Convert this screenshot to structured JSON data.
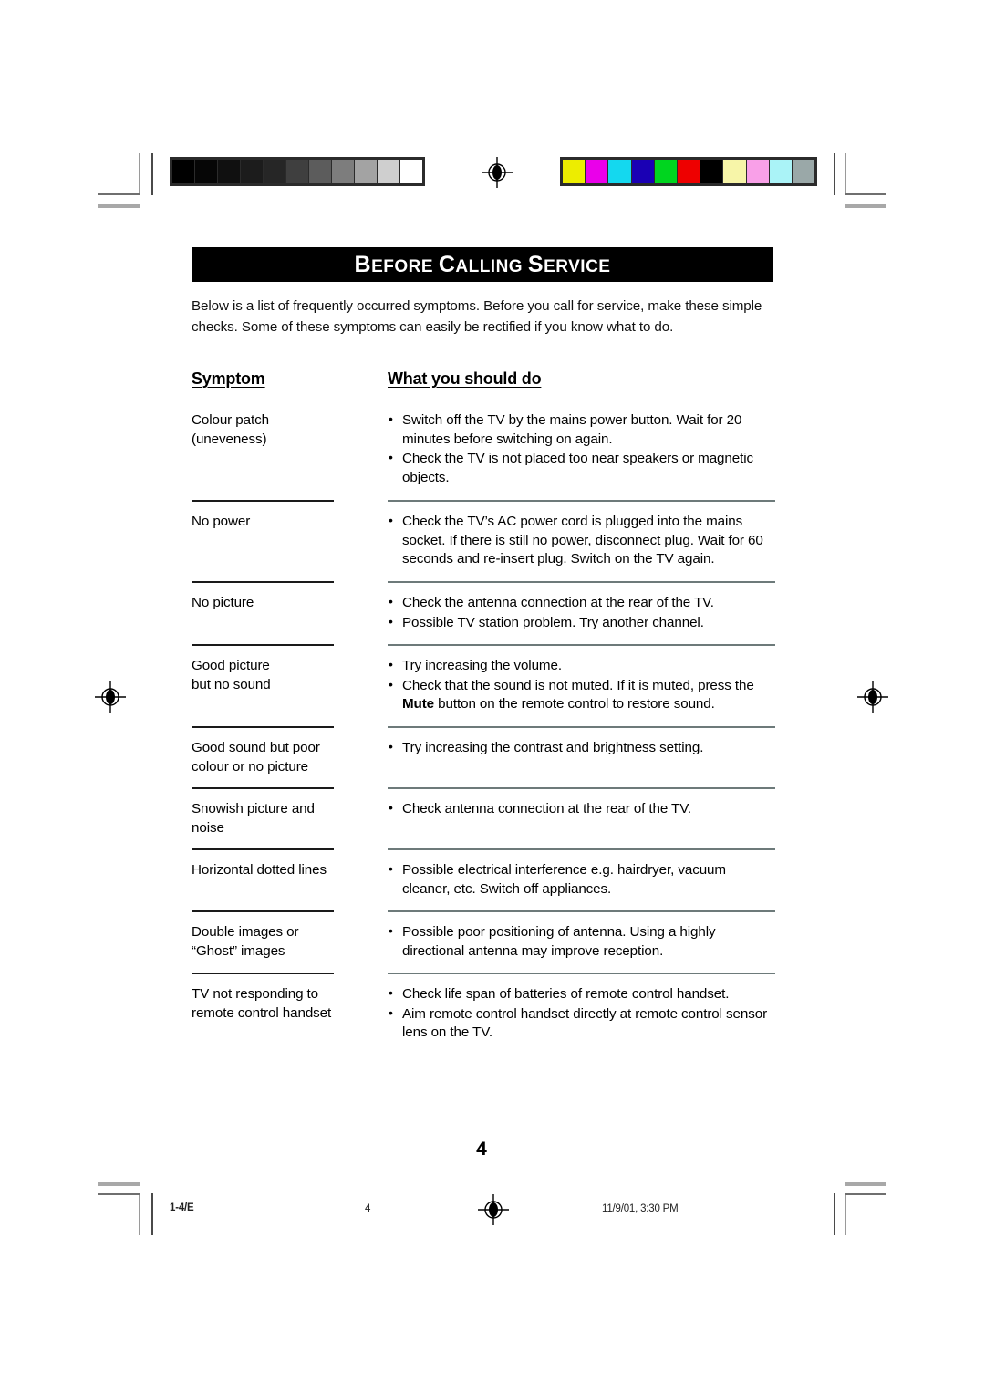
{
  "document": {
    "title_banner": {
      "word1_cap": "B",
      "word1_rest": "EFORE",
      "word2_cap": "C",
      "word2_rest": "ALLING",
      "word3_cap": "S",
      "word3_rest": "ERVICE",
      "full_text": "BEFORE CALLING SERVICE",
      "background": "#000000",
      "color": "#ffffff"
    },
    "intro": "Below is a list of frequently occurred symptoms. Before you call for service, make these simple checks. Some of these symptoms can easily be rectified if you know what to do.",
    "table": {
      "headers": {
        "symptom": "Symptom",
        "action": "What you should do"
      },
      "rows": [
        {
          "symptom": "Colour patch\n(uneveness)",
          "actions": [
            {
              "text": "Switch off the TV by the mains power button. Wait for 20 minutes before switching on again."
            },
            {
              "text": "Check the TV is not placed too near speakers or magnetic objects."
            }
          ]
        },
        {
          "symptom": "No power",
          "actions": [
            {
              "text": "Check the TV’s AC power cord is plugged into the mains socket. If there is still no power, disconnect plug. Wait for 60 seconds and re-insert plug. Switch on the TV again."
            }
          ]
        },
        {
          "symptom": "No picture",
          "actions": [
            {
              "text": "Check the antenna connection at the rear of the TV."
            },
            {
              "text": "Possible TV station problem. Try another channel."
            }
          ]
        },
        {
          "symptom": "Good picture\nbut no sound",
          "actions": [
            {
              "text": "Try increasing the volume."
            },
            {
              "pre": "Check that the sound is not muted. If it is muted, press the ",
              "bold": "Mute",
              "post": " button on the remote control to restore sound."
            }
          ]
        },
        {
          "symptom": "Good sound but poor\ncolour or no picture",
          "actions": [
            {
              "text": "Try increasing the contrast and brightness setting."
            }
          ]
        },
        {
          "symptom": "Snowish picture and\nnoise",
          "actions": [
            {
              "text": "Check antenna connection at the rear of the TV."
            }
          ]
        },
        {
          "symptom": "Horizontal dotted lines",
          "actions": [
            {
              "text": "Possible electrical interference e.g. hairdryer, vacuum cleaner, etc. Switch off appliances."
            }
          ]
        },
        {
          "symptom": "Double images or\n“Ghost” images",
          "actions": [
            {
              "text": "Possible poor positioning of antenna. Using a highly directional  antenna may improve reception."
            }
          ]
        },
        {
          "symptom": "TV not responding to\nremote control handset",
          "actions": [
            {
              "text": "Check life span of batteries of remote control handset."
            },
            {
              "text": "Aim remote control handset directly at remote control sensor lens on the TV."
            }
          ]
        }
      ]
    },
    "page_number": "4",
    "footer": {
      "left": "1-4/E",
      "center": "4",
      "right": "11/9/01, 3:30 PM"
    }
  },
  "print_marks": {
    "grayscale_patches": [
      "#000000",
      "#060606",
      "#101010",
      "#1c1c1c",
      "#262626",
      "#3f3f3f",
      "#5c5c5c",
      "#7d7d7d",
      "#a3a3a3",
      "#cfcfcf",
      "#ffffff"
    ],
    "color_patches": [
      "#eded00",
      "#ea00ea",
      "#14d8ef",
      "#1a00b4",
      "#00d51f",
      "#ee0000",
      "#000000",
      "#f7f5a8",
      "#f9a0e8",
      "#aaf3f7",
      "#9aa8a8"
    ],
    "registration_icon": "registration-crosshair"
  }
}
